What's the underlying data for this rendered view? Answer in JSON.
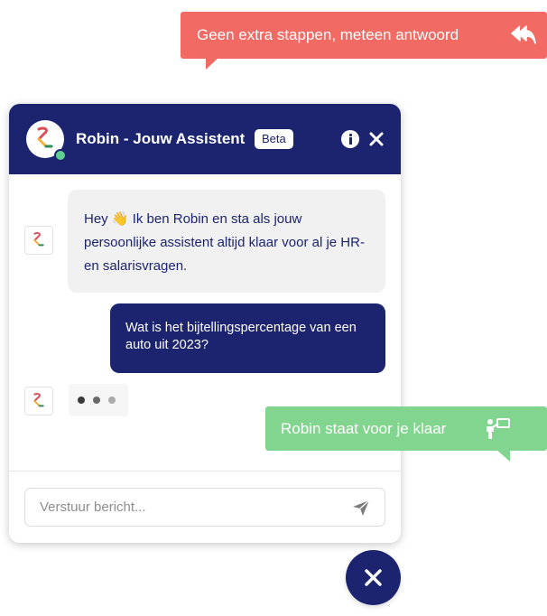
{
  "callouts": {
    "top_text": "Geen extra stappen, meteen antwoord",
    "top_icon": "reply-all-icon",
    "top_color": "#f26a64",
    "side_text": "Robin staat voor je klaar",
    "side_icon": "handover-icon",
    "side_color": "#82d58e"
  },
  "header": {
    "title": "Robin - Jouw Assistent",
    "badge": "Beta",
    "info_icon": "info-icon",
    "close_icon": "close-icon",
    "background": "#1c2470",
    "status_color": "#5fcf90"
  },
  "messages": [
    {
      "from": "bot",
      "greeting": "Hey",
      "emoji": "👋",
      "text": "Ik ben Robin en sta als jouw persoonlijke assistent altijd klaar voor al je HR- en salarisvragen."
    },
    {
      "from": "user",
      "text": "Wat is het bijtellingspercentage van een auto uit 2023?"
    }
  ],
  "typing_indicator": {
    "dot_colors": [
      "#3a3a3a",
      "#6a6a6a",
      "#aaaaaa"
    ]
  },
  "composer": {
    "placeholder": "Verstuur bericht...",
    "send_icon": "send-icon"
  },
  "launcher": {
    "icon": "close-icon"
  }
}
